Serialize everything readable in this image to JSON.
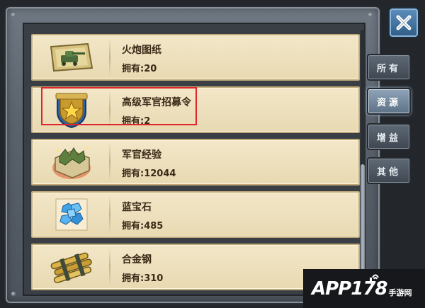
{
  "items": [
    {
      "name": "火炮图纸",
      "owned": "拥有:20",
      "icon": "cannon-blueprint-icon"
    },
    {
      "name": "高级军官招募令",
      "owned": "拥有:2",
      "icon": "officer-badge-icon"
    },
    {
      "name": "军官经验",
      "owned": "拥有:12044",
      "icon": "officer-experience-icon"
    },
    {
      "name": "蓝宝石",
      "owned": "拥有:485",
      "icon": "sapphire-icon"
    },
    {
      "name": "合金钢",
      "owned": "拥有:310",
      "icon": "alloy-steel-icon"
    }
  ],
  "tabs": [
    {
      "label": "所有",
      "active": false
    },
    {
      "label": "资源",
      "active": true
    },
    {
      "label": "增益",
      "active": false
    },
    {
      "label": "其他",
      "active": false
    }
  ],
  "close_icon": "close-icon",
  "watermark": {
    "main": "APP178",
    "sub": "手游网"
  },
  "colors": {
    "highlight": "#e0242a",
    "item_bg": "#f3e7c8",
    "text": "#3b2a18"
  }
}
